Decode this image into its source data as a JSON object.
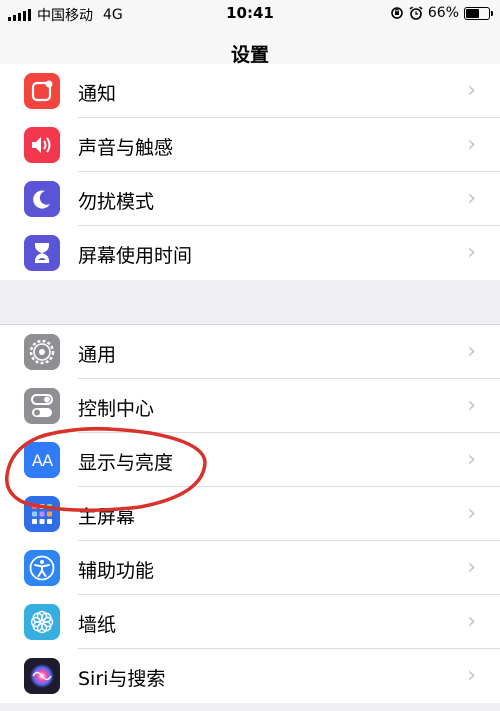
{
  "status_bar": {
    "carrier": "中国移动",
    "network": "4G",
    "time": "10:41",
    "battery_percent": "66%",
    "battery_level": 0.66
  },
  "nav": {
    "title": "设置"
  },
  "group1": [
    {
      "label": "通知",
      "icon": "notifications-icon",
      "color": "#f1453d"
    },
    {
      "label": "声音与触感",
      "icon": "speaker-icon",
      "color": "#f2374f"
    },
    {
      "label": "勿扰模式",
      "icon": "moon-icon",
      "color": "#5c54d6"
    },
    {
      "label": "屏幕使用时间",
      "icon": "hourglass-icon",
      "color": "#5c54d6"
    }
  ],
  "group2": [
    {
      "label": "通用",
      "icon": "gear-icon",
      "color": "#8e8e93"
    },
    {
      "label": "控制中心",
      "icon": "toggles-icon",
      "color": "#8e8e93"
    },
    {
      "label": "显示与亮度",
      "icon": "display-aa-icon",
      "color": "#2f7cf6",
      "icon_text": "AA"
    },
    {
      "label": "主屏幕",
      "icon": "homescreen-icon",
      "color": "#2f6ee8"
    },
    {
      "label": "辅助功能",
      "icon": "accessibility-icon",
      "color": "#2e86f5"
    },
    {
      "label": "墙纸",
      "icon": "wallpaper-flower-icon",
      "color": "#36aee0"
    },
    {
      "label": "Siri与搜索",
      "icon": "siri-icon",
      "color": "#1c1c2e"
    }
  ],
  "chevron": "›",
  "annotation_color": "#d8332b"
}
